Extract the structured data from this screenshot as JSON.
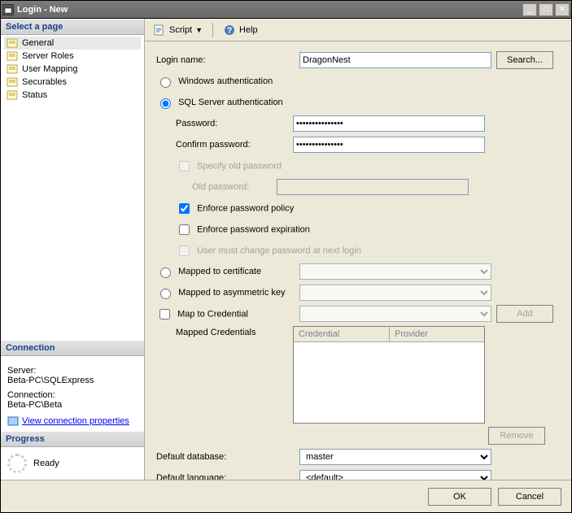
{
  "window": {
    "title": "Login - New"
  },
  "sidebar": {
    "header": "Select a page",
    "items": [
      {
        "label": "General"
      },
      {
        "label": "Server Roles"
      },
      {
        "label": "User Mapping"
      },
      {
        "label": "Securables"
      },
      {
        "label": "Status"
      }
    ]
  },
  "connection": {
    "header": "Connection",
    "server_label": "Server:",
    "server_value": "Beta-PC\\SQLExpress",
    "conn_label": "Connection:",
    "conn_value": "Beta-PC\\Beta",
    "link": "View connection properties"
  },
  "progress": {
    "header": "Progress",
    "status": "Ready"
  },
  "toolbar": {
    "script": "Script",
    "help": "Help"
  },
  "form": {
    "login_name_label": "Login name:",
    "login_name_value": "DragonNest",
    "search_btn": "Search...",
    "windows_auth": "Windows authentication",
    "sql_auth": "SQL Server authentication",
    "password_label": "Password:",
    "password_value": "●●●●●●●●●●●●●●●",
    "confirm_label": "Confirm password:",
    "confirm_value": "●●●●●●●●●●●●●●●",
    "specify_old": "Specify old password",
    "old_password_label": "Old password:",
    "enforce_policy": "Enforce password policy",
    "enforce_expiration": "Enforce password expiration",
    "must_change": "User must change password at next login",
    "mapped_cert": "Mapped to certificate",
    "mapped_asym": "Mapped to asymmetric key",
    "map_credential": "Map to Credential",
    "add_btn": "Add",
    "mapped_creds_label": "Mapped Credentials",
    "cred_col1": "Credential",
    "cred_col2": "Provider",
    "remove_btn": "Remove",
    "default_db_label": "Default database:",
    "default_db_value": "master",
    "default_lang_label": "Default language:",
    "default_lang_value": "<default>"
  },
  "footer": {
    "ok": "OK",
    "cancel": "Cancel"
  }
}
